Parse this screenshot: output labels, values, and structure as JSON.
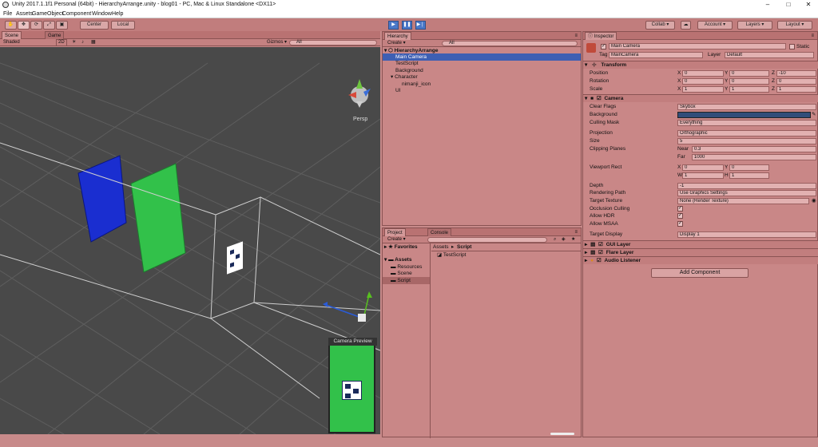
{
  "window": {
    "title": "Unity 2017.1.1f1 Personal (64bit) - HierarchyArrange.unity - blog01 - PC, Mac & Linux Standalone <DX11>",
    "min": "–",
    "max": "□",
    "close": "✕"
  },
  "menu": [
    "File",
    "Assets",
    "GameObject",
    "Component",
    "Window",
    "Help"
  ],
  "toolbar": {
    "center": "Center",
    "local": "Local",
    "collab": "Collab ▾",
    "account": "Account ▾",
    "layers": "Layers ▾",
    "layout": "Layout ▾"
  },
  "scene": {
    "tab_scene": "Scene",
    "tab_game": "Game",
    "shaded": "Shaded",
    "mode2d": "2D",
    "gizmos": "Gizmos ▾",
    "search_placeholder": "All",
    "persp": "Persp",
    "camera_preview": "Camera Preview"
  },
  "hierarchy": {
    "tab": "Hierarchy",
    "create": "Create ▾",
    "search_placeholder": "All",
    "scene": "HierarchyArrange",
    "items": [
      {
        "label": "Main Camera"
      },
      {
        "label": "TestScript"
      },
      {
        "label": "Background"
      },
      {
        "label": "Character"
      },
      {
        "label": "nimanji_icon"
      },
      {
        "label": "UI"
      }
    ]
  },
  "project": {
    "tab_project": "Project",
    "tab_console": "Console",
    "create": "Create ▾",
    "favorites": "Favorites",
    "assets": "Assets",
    "folders": [
      "Resources",
      "Scene",
      "Script"
    ],
    "breadcrumb_assets": "Assets",
    "breadcrumb_sep": "▸",
    "breadcrumb_script": "Script",
    "files": [
      "TestScript"
    ]
  },
  "inspector": {
    "tab": "Inspector",
    "object_name": "Main Camera",
    "static_label": "Static",
    "tag_label": "Tag",
    "tag_value": "MainCamera",
    "layer_label": "Layer",
    "layer_value": "Default",
    "transform": {
      "title": "Transform",
      "position": "Position",
      "rotation": "Rotation",
      "scale": "Scale",
      "px": "0",
      "py": "0",
      "pz": "-10",
      "rx": "0",
      "ry": "0",
      "rz": "0",
      "sx": "1",
      "sy": "1",
      "sz": "1"
    },
    "axis_x": "X",
    "axis_y": "Y",
    "axis_z": "Z",
    "axis_w": "W",
    "axis_h": "H",
    "camera": {
      "title": "Camera",
      "clear_flags_label": "Clear Flags",
      "clear_flags": "Skybox",
      "background_label": "Background",
      "culling_label": "Culling Mask",
      "culling": "Everything",
      "projection_label": "Projection",
      "projection": "Orthographic",
      "size_label": "Size",
      "size": "5",
      "clipping_label": "Clipping Planes",
      "near_label": "Near",
      "near": "0.3",
      "far_label": "Far",
      "far": "1000",
      "viewport_label": "Viewport Rect",
      "vx": "0",
      "vy": "0",
      "vw": "1",
      "vh": "1",
      "depth_label": "Depth",
      "depth": "-1",
      "rendering_label": "Rendering Path",
      "rendering": "Use Graphics Settings",
      "target_tex_label": "Target Texture",
      "target_tex": "None (Render Texture)",
      "occlusion_label": "Occlusion Culling",
      "hdr_label": "Allow HDR",
      "msaa_label": "Allow MSAA",
      "display_label": "Target Display",
      "display": "Display 1"
    },
    "gui_layer": "GUI Layer",
    "flare_layer": "Flare Layer",
    "audio_listener": "Audio Listener",
    "add_component": "Add Component"
  },
  "colors": {
    "accent": "#3e5fb3",
    "blue_quad": "#1a2ed0",
    "green_quad": "#32c14a",
    "camera_bg": "#314d79",
    "scene_bg": "#494949"
  }
}
